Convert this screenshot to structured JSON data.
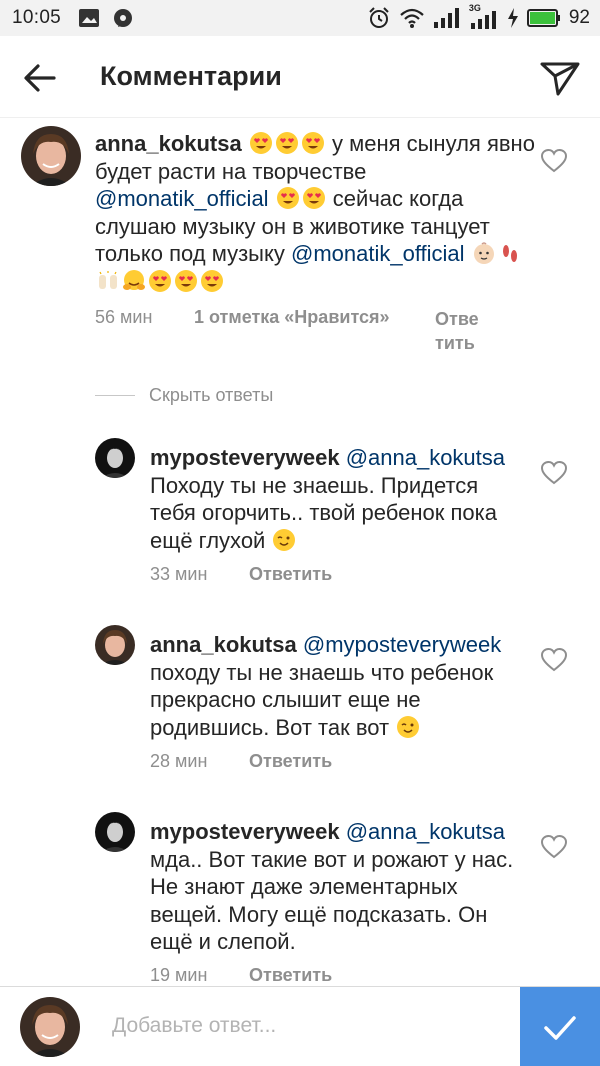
{
  "status_bar": {
    "time": "10:05",
    "battery_percent": "92",
    "network_label": "3G"
  },
  "header": {
    "title": "Комментарии"
  },
  "hide_replies_label": "Скрыть ответы",
  "comments": [
    {
      "username": "anna_kokutsa",
      "text_1": " у меня сынуля явно будет расти на творчестве ",
      "mention_1": "@monatik_official",
      "text_2": " сейчас когда слушаю музыку он в животике танцует только под музыку ",
      "mention_2": "@monatik_official",
      "time": "56 мин",
      "likes": "1 отметка «Нравится»",
      "reply_label": "Ответить"
    },
    {
      "username": "myposteveryweek",
      "mention": "@anna_kokutsa",
      "text": "Походу ты не знаешь. Придется тебя огорчить.. твой ребенок пока ещё глухой",
      "time": "33 мин",
      "reply_label": "Ответить"
    },
    {
      "username": "anna_kokutsa",
      "mention": "@myposteveryweek",
      "text": "походу ты не знаешь что ребенок прекрасно слышит еще не родившись. Вот так вот",
      "time": "28 мин",
      "reply_label": "Ответить"
    },
    {
      "username": "myposteveryweek",
      "mention": "@anna_kokutsa",
      "text": "мда.. Вот такие вот и рожают у нас. Не знают даже элементарных вещей. Могу ещё подсказать. Он ещё и слепой.",
      "time": "19 мин",
      "reply_label": "Ответить"
    }
  ],
  "compose": {
    "placeholder": "Добавьте ответ..."
  },
  "colors": {
    "mention": "#003569",
    "post_button": "#4a90e2",
    "meta_gray": "#8e8e8e"
  }
}
